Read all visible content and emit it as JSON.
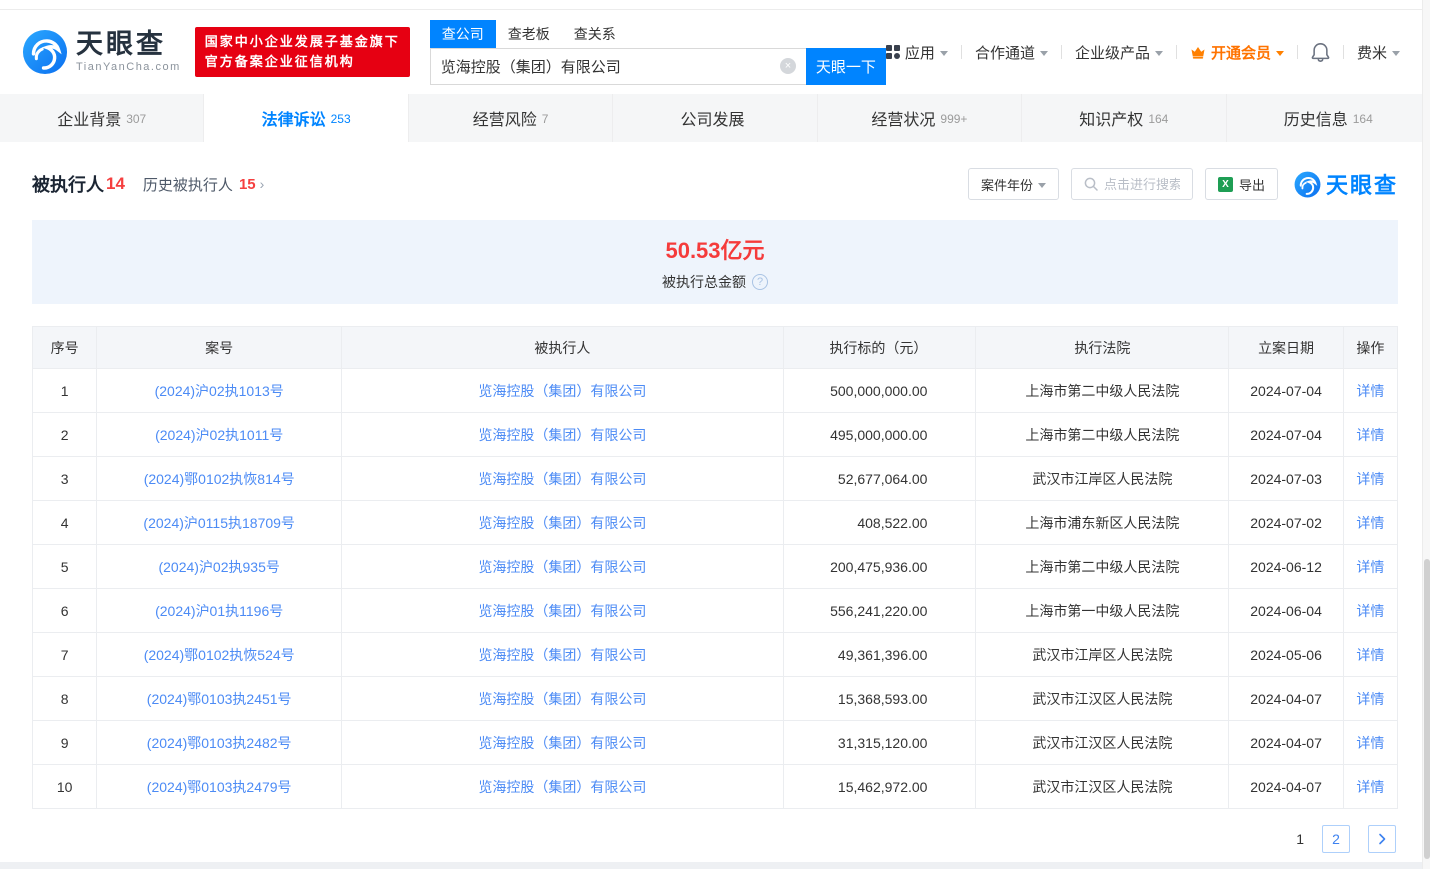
{
  "header": {
    "logo": {
      "brand": "天眼查",
      "domain": "TianYanCha.com"
    },
    "badge": {
      "line1": "国家中小企业发展子基金旗下",
      "line2": "官方备案企业征信机构"
    },
    "search": {
      "tabs": [
        {
          "label": "查公司",
          "active": true
        },
        {
          "label": "查老板",
          "active": false
        },
        {
          "label": "查关系",
          "active": false
        }
      ],
      "value": "览海控股（集团）有限公司",
      "clear_icon": "×",
      "button": "天眼一下"
    },
    "menu": {
      "apps": "应用",
      "partner": "合作通道",
      "enterprise": "企业级产品",
      "vip": "开通会员",
      "user": "费米"
    }
  },
  "nav_tabs": [
    {
      "label": "企业背景",
      "count": "307",
      "active": false
    },
    {
      "label": "法律诉讼",
      "count": "253",
      "active": true
    },
    {
      "label": "经营风险",
      "count": "7",
      "active": false
    },
    {
      "label": "公司发展",
      "count": "",
      "active": false
    },
    {
      "label": "经营状况",
      "count": "999+",
      "active": false
    },
    {
      "label": "知识产权",
      "count": "164",
      "active": false
    },
    {
      "label": "历史信息",
      "count": "164",
      "active": false
    }
  ],
  "section": {
    "title": "被执行人",
    "title_count": "14",
    "history_label": "历史被执行人",
    "history_count": "15",
    "history_arrow": "›",
    "year_filter": "案件年份",
    "search_placeholder": "点击进行搜索",
    "export_label": "导出",
    "export_icon_text": "X",
    "watermark_brand": "天眼查"
  },
  "summary": {
    "amount": "50.53亿元",
    "label": "被执行总金额",
    "help": "?"
  },
  "table": {
    "headers": {
      "no": "序号",
      "case_no": "案号",
      "person": "被执行人",
      "amount": "执行标的（元）",
      "court": "执行法院",
      "date": "立案日期",
      "action": "操作"
    },
    "detail_label": "详情",
    "rows": [
      {
        "no": "1",
        "case_no": "(2024)沪02执1013号",
        "person": "览海控股（集团）有限公司",
        "amount": "500,000,000.00",
        "court": "上海市第二中级人民法院",
        "date": "2024-07-04"
      },
      {
        "no": "2",
        "case_no": "(2024)沪02执1011号",
        "person": "览海控股（集团）有限公司",
        "amount": "495,000,000.00",
        "court": "上海市第二中级人民法院",
        "date": "2024-07-04"
      },
      {
        "no": "3",
        "case_no": "(2024)鄂0102执恢814号",
        "person": "览海控股（集团）有限公司",
        "amount": "52,677,064.00",
        "court": "武汉市江岸区人民法院",
        "date": "2024-07-03"
      },
      {
        "no": "4",
        "case_no": "(2024)沪0115执18709号",
        "person": "览海控股（集团）有限公司",
        "amount": "408,522.00",
        "court": "上海市浦东新区人民法院",
        "date": "2024-07-02"
      },
      {
        "no": "5",
        "case_no": "(2024)沪02执935号",
        "person": "览海控股（集团）有限公司",
        "amount": "200,475,936.00",
        "court": "上海市第二中级人民法院",
        "date": "2024-06-12"
      },
      {
        "no": "6",
        "case_no": "(2024)沪01执1196号",
        "person": "览海控股（集团）有限公司",
        "amount": "556,241,220.00",
        "court": "上海市第一中级人民法院",
        "date": "2024-06-04"
      },
      {
        "no": "7",
        "case_no": "(2024)鄂0102执恢524号",
        "person": "览海控股（集团）有限公司",
        "amount": "49,361,396.00",
        "court": "武汉市江岸区人民法院",
        "date": "2024-05-06"
      },
      {
        "no": "8",
        "case_no": "(2024)鄂0103执2451号",
        "person": "览海控股（集团）有限公司",
        "amount": "15,368,593.00",
        "court": "武汉市江汉区人民法院",
        "date": "2024-04-07"
      },
      {
        "no": "9",
        "case_no": "(2024)鄂0103执2482号",
        "person": "览海控股（集团）有限公司",
        "amount": "31,315,120.00",
        "court": "武汉市江汉区人民法院",
        "date": "2024-04-07"
      },
      {
        "no": "10",
        "case_no": "(2024)鄂0103执2479号",
        "person": "览海控股（集团）有限公司",
        "amount": "15,462,972.00",
        "court": "武汉市江汉区人民法院",
        "date": "2024-04-07"
      }
    ]
  },
  "pagination": {
    "current": "1",
    "page2": "2",
    "next": "›"
  },
  "colors": {
    "primary": "#0084ff",
    "link": "#4c8bf5",
    "red": "#f53f3f",
    "badge_red": "#e60012",
    "vip_orange": "#ff7300",
    "banner_bg": "#eef4fc"
  }
}
